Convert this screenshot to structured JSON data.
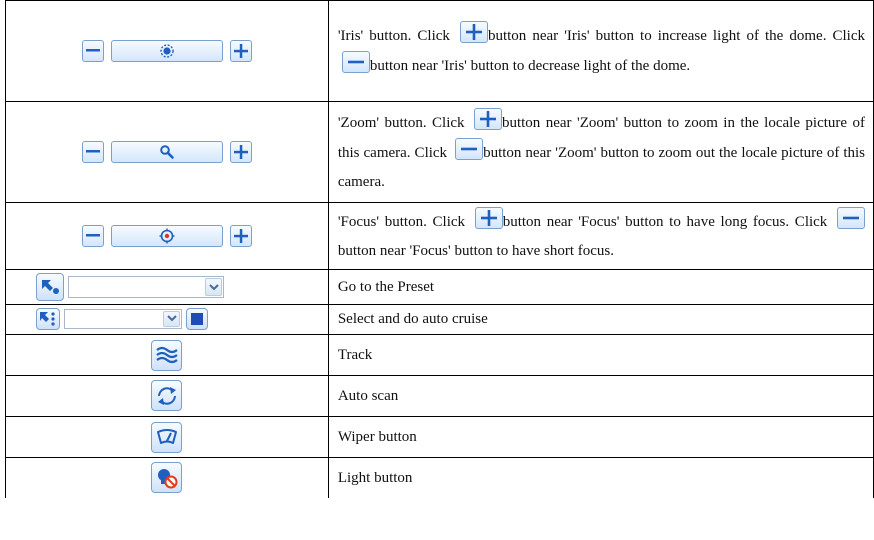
{
  "colors": {
    "button_blue": "#1e5fbf",
    "button_border": "#7aa0d0",
    "stop_blue": "#1f4db3",
    "no_red": "#e23b1d"
  },
  "rows": [
    {
      "control": "iris",
      "icons": [
        "minus-icon",
        "iris-icon",
        "plus-icon"
      ],
      "desc": {
        "t1": "'Iris' button. Click ",
        "t2": "button near 'Iris' button to increase light of the dome. Click ",
        "t3": "button near 'Iris' button to decrease light of the dome."
      }
    },
    {
      "control": "zoom",
      "icons": [
        "minus-icon",
        "zoom-icon",
        "plus-icon"
      ],
      "desc": {
        "t1": "'Zoom' button. Click ",
        "t2": "button near 'Zoom' button to zoom in the locale picture of this camera. Click ",
        "t3": "button near 'Zoom' button to zoom out the locale picture of this camera."
      }
    },
    {
      "control": "focus",
      "icons": [
        "minus-icon",
        "focus-icon",
        "plus-icon"
      ],
      "desc": {
        "t1": "'Focus' button. Click ",
        "t2": "button near 'Focus' button to have long focus. Click ",
        "t3": "button near 'Focus' button to have short focus."
      }
    },
    {
      "control": "preset",
      "icons": [
        "goto-preset-icon",
        "chevron-down-icon"
      ],
      "desc": {
        "text": "Go to the Preset"
      }
    },
    {
      "control": "cruise",
      "icons": [
        "cruise-icon",
        "chevron-down-icon",
        "stop-icon"
      ],
      "desc": {
        "text": "Select and do auto cruise"
      }
    },
    {
      "control": "track",
      "icons": [
        "track-icon"
      ],
      "desc": {
        "text": "Track"
      }
    },
    {
      "control": "autoscan",
      "icons": [
        "auto-scan-icon"
      ],
      "desc": {
        "text": "Auto scan"
      }
    },
    {
      "control": "wiper",
      "icons": [
        "wiper-icon"
      ],
      "desc": {
        "text": "Wiper button"
      }
    },
    {
      "control": "light",
      "icons": [
        "light-icon"
      ],
      "desc": {
        "text": "Light button"
      }
    }
  ]
}
